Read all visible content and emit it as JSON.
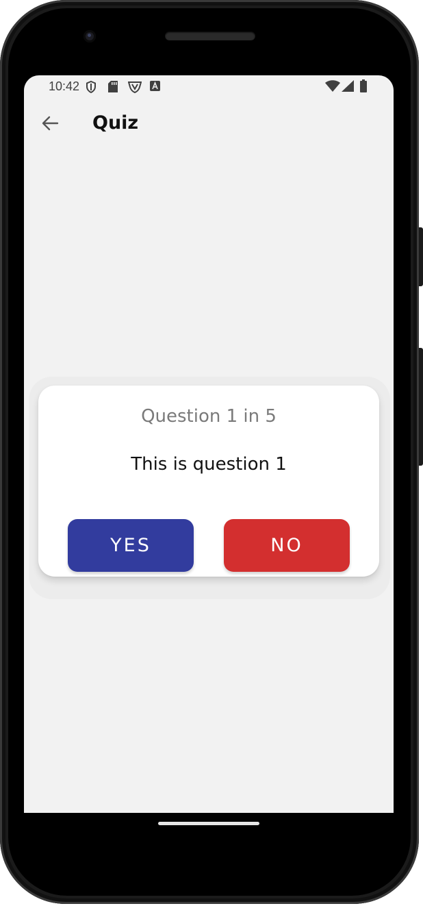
{
  "status_bar": {
    "time": "10:42",
    "left_icons": [
      "shield-icon",
      "sd-card-icon",
      "vpn-shield-icon",
      "keyboard-a-icon"
    ],
    "right_icons": [
      "wifi-icon",
      "signal-icon",
      "battery-icon"
    ]
  },
  "app_bar": {
    "title": "Quiz",
    "back_icon": "arrow-back-icon"
  },
  "quiz": {
    "counter": "Question 1 in 5",
    "question": "This is question 1",
    "yes_label": "YES",
    "no_label": "NO"
  },
  "colors": {
    "yes_button": "#323C9E",
    "no_button": "#D32F2F",
    "screen_bg": "#F2F2F2",
    "card_bg": "#FFFFFF",
    "counter_text": "#7A7A7A"
  }
}
